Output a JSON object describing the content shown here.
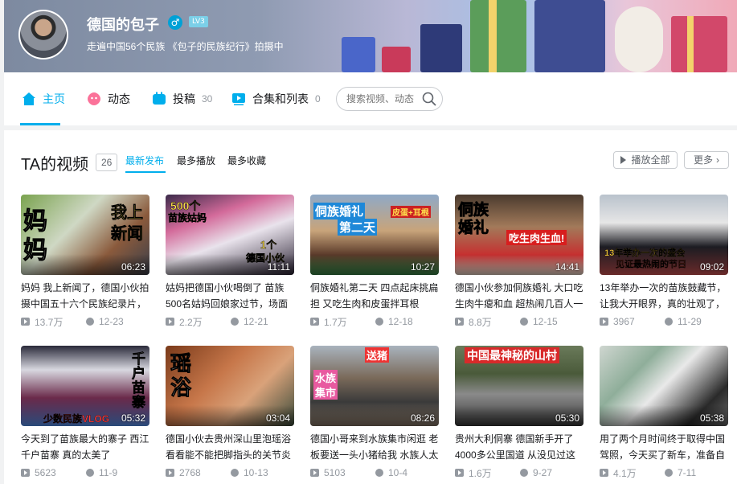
{
  "profile": {
    "name": "德国的包子",
    "gender_icon": "♂",
    "level": "LV3",
    "sign": "走遍中国56个民族 《包子的民族纪行》拍摄中"
  },
  "nav": {
    "items": [
      {
        "label": "主页",
        "count": "",
        "icon": "home-icon"
      },
      {
        "label": "动态",
        "count": "",
        "icon": "dynamic-icon"
      },
      {
        "label": "投稿",
        "count": "30",
        "icon": "upload-icon"
      },
      {
        "label": "合集和列表",
        "count": "0",
        "icon": "collection-icon"
      }
    ],
    "search_placeholder": "搜索视频、动态"
  },
  "section": {
    "title": "TA的视频",
    "count": "26",
    "sorts": [
      "最新发布",
      "最多播放",
      "最多收藏"
    ],
    "play_all": "播放全部",
    "more": "更多"
  },
  "colors": {
    "accent": "#00aeec",
    "meta": "#9499a0"
  },
  "videos": [
    {
      "title": "妈妈 我上新闻了，德国小伙拍摄中国五十六个民族纪录片，",
      "duration": "06:23",
      "plays": "13.7万",
      "date": "12-23",
      "overlay": [
        "妈",
        "妈",
        "我上",
        "新闻"
      ]
    },
    {
      "title": "姑妈把德国小伙喝倒了 苗族500名姑妈回娘家过节，场面",
      "duration": "11:11",
      "plays": "2.2万",
      "date": "12-21",
      "overlay": [
        "500个",
        "苗族姑妈",
        "1个",
        "德国小伙"
      ]
    },
    {
      "title": "侗族婚礼第二天 四点起床挑扁担 又吃生肉和皮蛋拌耳根",
      "duration": "10:27",
      "plays": "1.7万",
      "date": "12-18",
      "overlay": [
        "侗族婚礼",
        "第二天",
        "皮蛋+耳根"
      ]
    },
    {
      "title": "德国小伙参加侗族婚礼 大口吃生肉牛瘪和血 超热闹几百人一",
      "duration": "14:41",
      "plays": "8.8万",
      "date": "12-15",
      "overlay": [
        "侗族",
        "婚礼",
        "吃生肉生血!"
      ]
    },
    {
      "title": "13年举办一次的苗族鼓藏节，让我大开眼界，真的壮观了，",
      "duration": "09:02",
      "plays": "3967",
      "date": "11-29",
      "overlay": [
        "13年举办一次的盛会",
        "见证最热闹的节日"
      ]
    },
    {
      "title": "今天到了苗族最大的寨子 西江千户苗寨 真的太美了",
      "duration": "05:32",
      "plays": "5623",
      "date": "11-9",
      "overlay": [
        "千",
        "户",
        "苗",
        "寨",
        "少数民族VLOG"
      ]
    },
    {
      "title": "德国小伙去贵州深山里泡瑶浴 看看能不能把脚指头的关节炎",
      "duration": "03:04",
      "plays": "2768",
      "date": "10-13",
      "overlay": [
        "瑶",
        "浴"
      ]
    },
    {
      "title": "德国小哥来到水族集市闲逛 老板要送一头小猪给我 水族人太",
      "duration": "08:26",
      "plays": "5103",
      "date": "10-4",
      "overlay": [
        "送猪",
        "水族",
        "集市"
      ]
    },
    {
      "title": "贵州大利侗寨 德国新手开了4000多公里国道 从没见过这",
      "duration": "05:30",
      "plays": "1.6万",
      "date": "9-27",
      "overlay": [
        "中国最神秘的山村"
      ]
    },
    {
      "title": "用了两个月时间终于取得中国驾照，今天买了新车，准备自",
      "duration": "05:38",
      "plays": "4.1万",
      "date": "7-11",
      "overlay": []
    }
  ]
}
